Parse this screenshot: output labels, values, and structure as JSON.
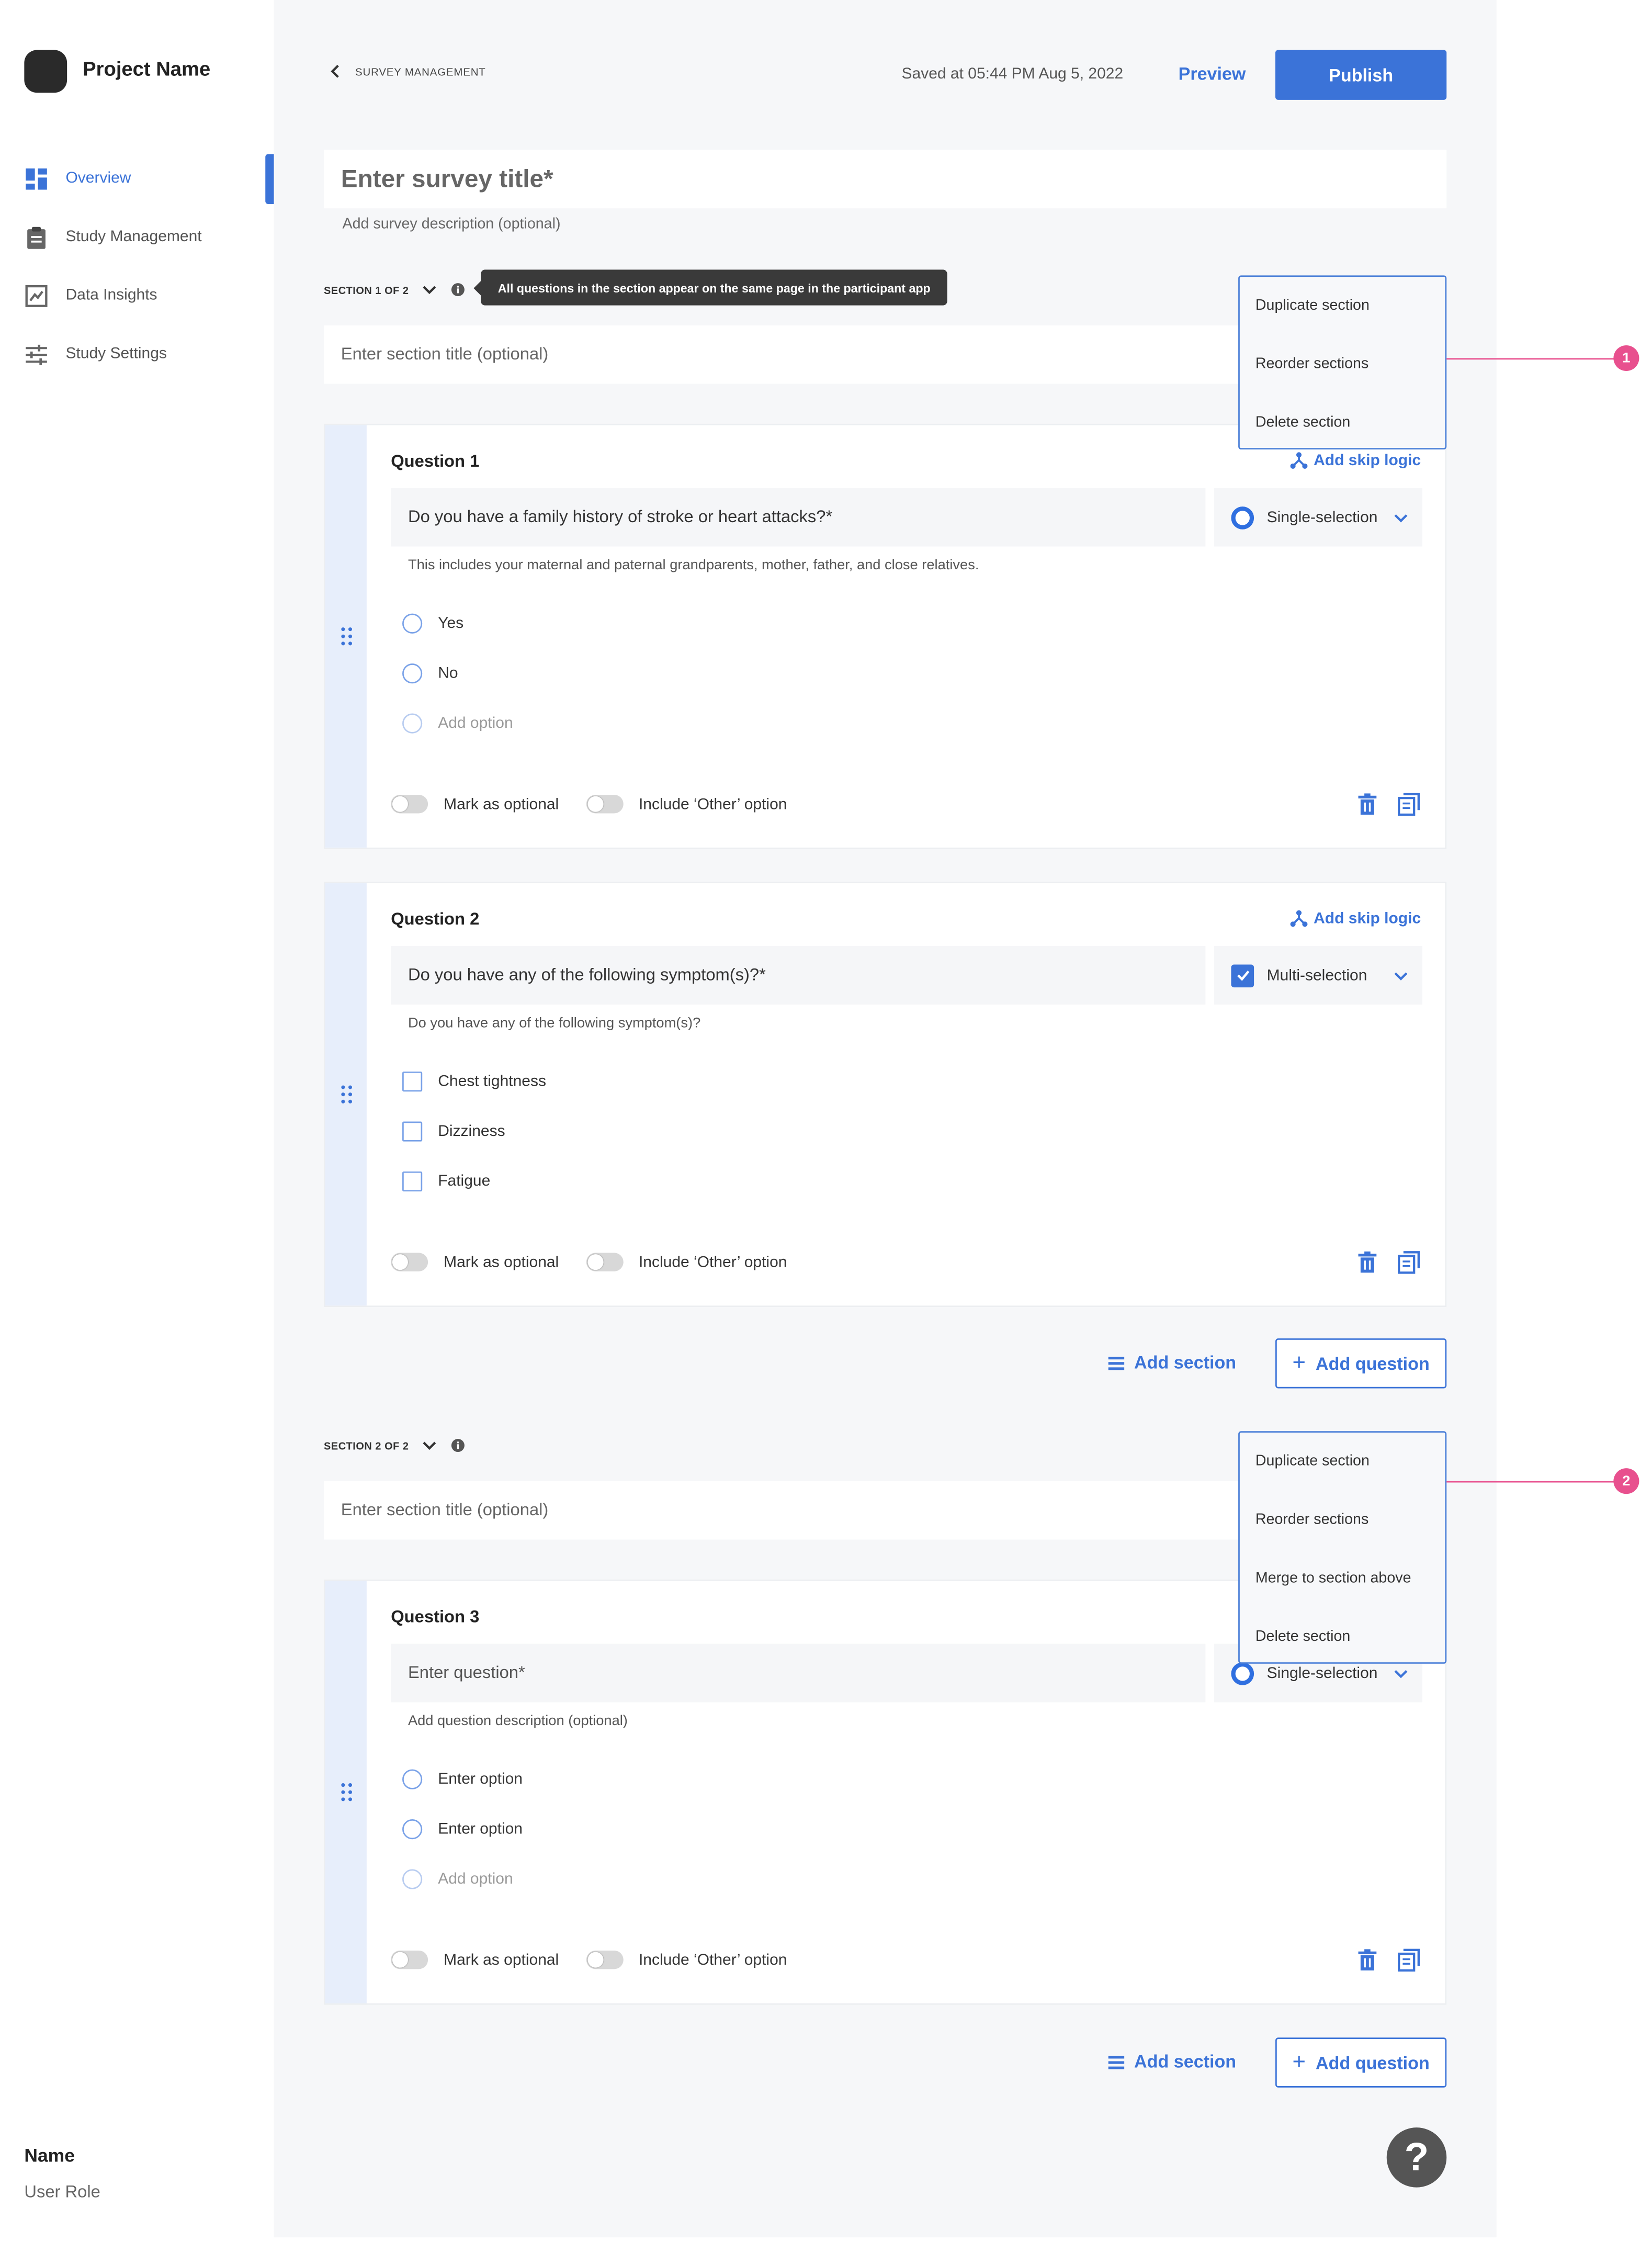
{
  "sidebar": {
    "project_name": "Project Name",
    "items": [
      {
        "label": "Overview",
        "icon": "dashboard-icon",
        "active": true
      },
      {
        "label": "Study Management",
        "icon": "clipboard-icon"
      },
      {
        "label": "Data Insights",
        "icon": "chart-icon"
      },
      {
        "label": "Study Settings",
        "icon": "sliders-icon"
      }
    ],
    "user": {
      "name": "Name",
      "role": "User Role"
    }
  },
  "header": {
    "breadcrumb": "SURVEY MANAGEMENT",
    "saved_status": "Saved at 05:44 PM Aug 5, 2022",
    "preview_label": "Preview",
    "publish_label": "Publish"
  },
  "survey": {
    "title_placeholder": "Enter survey title*",
    "description_placeholder": "Add survey description (optional)"
  },
  "sections": [
    {
      "label": "SECTION 1 OF 2",
      "tooltip": "All questions in the section appear on the same page in the participant app",
      "title_placeholder": "Enter section title (optional)",
      "menu": [
        "Duplicate section",
        "Reorder sections",
        "Delete section"
      ],
      "callout": "1"
    },
    {
      "label": "SECTION 2 OF 2",
      "title_placeholder": "Enter section title (optional)",
      "menu": [
        "Duplicate section",
        "Reorder sections",
        "Merge to section above",
        "Delete section"
      ],
      "callout": "2"
    }
  ],
  "questions": [
    {
      "label": "Question 1",
      "skip_logic": "Add skip logic",
      "text": "Do you have a family history of stroke or heart attacks?*",
      "type": "Single-selection",
      "description": "This includes your maternal and paternal grandparents, mother, father, and close relatives.",
      "options": [
        "Yes",
        "No"
      ],
      "add_option": "Add option",
      "optional_label": "Mark as optional",
      "other_label": "Include ‘Other’ option"
    },
    {
      "label": "Question 2",
      "skip_logic": "Add skip logic",
      "text": "Do you have any of the following symptom(s)?*",
      "type": "Multi-selection",
      "description": "Do you have any of the following symptom(s)?",
      "options": [
        "Chest tightness",
        "Dizziness",
        "Fatigue"
      ],
      "optional_label": "Mark as optional",
      "other_label": "Include ‘Other’ option"
    },
    {
      "label": "Question 3",
      "text_placeholder": "Enter question*",
      "type": "Single-selection",
      "description_placeholder": "Add question description (optional)",
      "options": [
        "Enter option",
        "Enter option"
      ],
      "add_option": "Add option",
      "optional_label": "Mark as optional",
      "other_label": "Include ‘Other’ option"
    }
  ],
  "actions": {
    "add_section": "Add section",
    "add_question": "Add question"
  },
  "help_label": "?",
  "colors": {
    "accent": "#3b73d8",
    "callout": "#e8508e",
    "background": "#f6f7f9"
  }
}
